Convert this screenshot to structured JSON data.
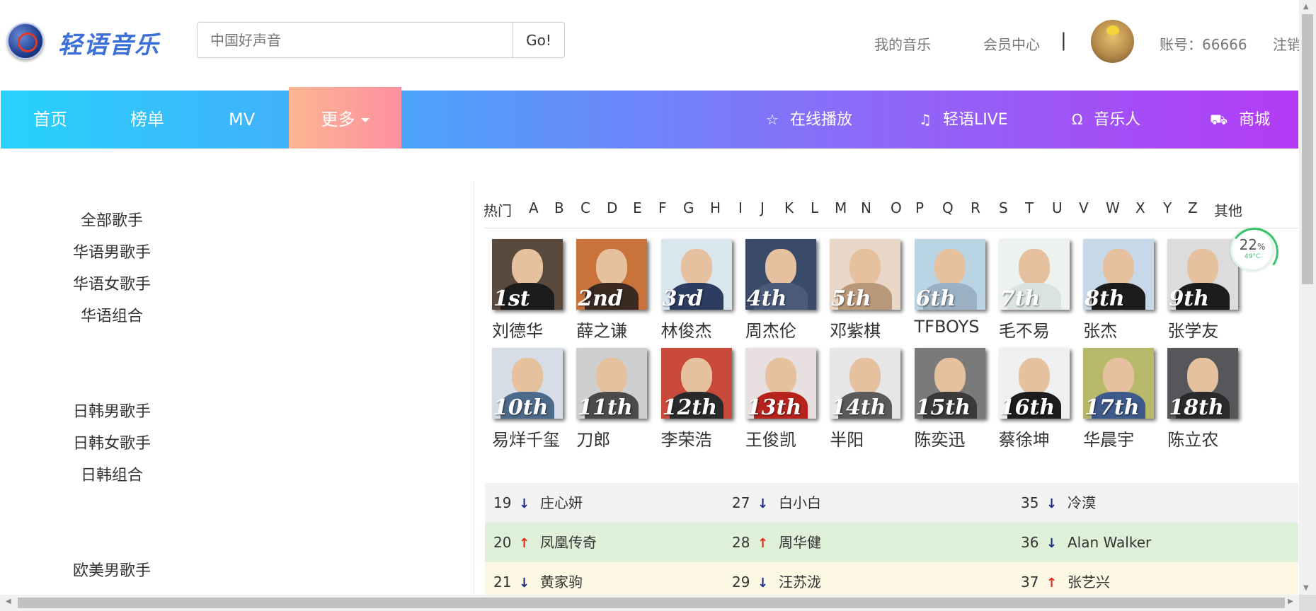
{
  "header": {
    "brand": "轻语音乐",
    "search_placeholder": "中国好声音",
    "search_button": "Go!",
    "my_music": "我的音乐",
    "member_center": "会员中心",
    "separator": "|",
    "account": "账号：66666",
    "logout": "注销"
  },
  "nav": {
    "items": [
      {
        "label": "首页"
      },
      {
        "label": "榜单"
      },
      {
        "label": "MV"
      }
    ],
    "more": "更多",
    "right": [
      {
        "label": "在线播放",
        "icon": "star-icon"
      },
      {
        "label": "轻语LIVE",
        "icon": "music-note-icon"
      },
      {
        "label": "音乐人",
        "icon": "headphones-icon"
      },
      {
        "label": "商城",
        "icon": "cart-icon"
      }
    ]
  },
  "sidebar": {
    "categories": [
      "全部歌手",
      "华语男歌手",
      "华语女歌手",
      "华语组合",
      "日韩男歌手",
      "日韩女歌手",
      "日韩组合",
      "欧美男歌手"
    ]
  },
  "letters": [
    "热门",
    "A",
    "B",
    "C",
    "D",
    "E",
    "F",
    "G",
    "H",
    "I",
    "J",
    "K",
    "L",
    "M",
    "N",
    "O",
    "P",
    "Q",
    "R",
    "S",
    "T",
    "U",
    "V",
    "W",
    "X",
    "Y",
    "Z",
    "其他"
  ],
  "singers": [
    {
      "rank": "1st",
      "name": "刘德华"
    },
    {
      "rank": "2nd",
      "name": "薛之谦"
    },
    {
      "rank": "3rd",
      "name": "林俊杰"
    },
    {
      "rank": "4th",
      "name": "周杰伦"
    },
    {
      "rank": "5th",
      "name": "邓紫棋"
    },
    {
      "rank": "6th",
      "name": "TFBOYS"
    },
    {
      "rank": "7th",
      "name": "毛不易"
    },
    {
      "rank": "8th",
      "name": "张杰"
    },
    {
      "rank": "9th",
      "name": "张学友"
    },
    {
      "rank": "10th",
      "name": "易烊千玺"
    },
    {
      "rank": "11th",
      "name": "刀郎"
    },
    {
      "rank": "12th",
      "name": "李荣浩"
    },
    {
      "rank": "13th",
      "name": "王俊凯"
    },
    {
      "rank": "14th",
      "name": "半阳"
    },
    {
      "rank": "15th",
      "name": "陈奕迅"
    },
    {
      "rank": "16th",
      "name": "蔡徐坤"
    },
    {
      "rank": "17th",
      "name": "华晨宇"
    },
    {
      "rank": "18th",
      "name": "陈立农"
    }
  ],
  "ranking": [
    {
      "cells": [
        {
          "num": "19",
          "trend": "down",
          "name": "庄心妍"
        },
        {
          "num": "27",
          "trend": "down",
          "name": "白小白"
        },
        {
          "num": "35",
          "trend": "down",
          "name": "冷漠"
        }
      ],
      "bg": "#f2f2f2"
    },
    {
      "cells": [
        {
          "num": "20",
          "trend": "up",
          "name": "凤凰传奇"
        },
        {
          "num": "28",
          "trend": "up",
          "name": "周华健"
        },
        {
          "num": "36",
          "trend": "down",
          "name": "Alan Walker"
        }
      ],
      "bg": "#dff0d8"
    },
    {
      "cells": [
        {
          "num": "21",
          "trend": "down",
          "name": "黄家驹"
        },
        {
          "num": "29",
          "trend": "down",
          "name": "汪苏泷"
        },
        {
          "num": "37",
          "trend": "up",
          "name": "张艺兴"
        }
      ],
      "bg": "#fcf8e3"
    }
  ],
  "gauge": {
    "percent": "22",
    "unit": "%",
    "temp": "49°C"
  },
  "colors": {
    "nav_start": "#27d2fb",
    "nav_end": "#b33bf5",
    "more_start": "#fcb692",
    "more_end": "#fd8fa0"
  }
}
